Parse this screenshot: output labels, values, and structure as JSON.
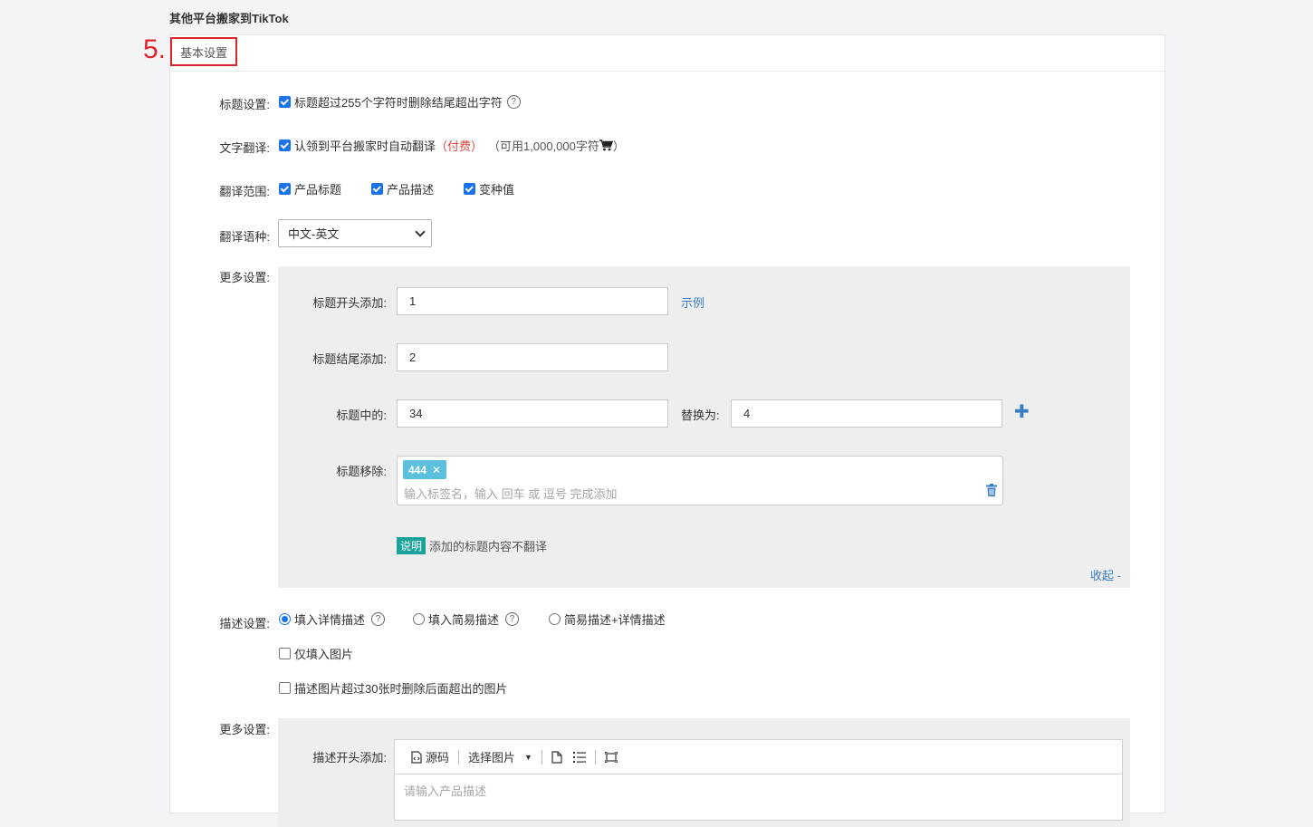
{
  "page_title": "其他平台搬家到TikTok",
  "step_marker": "5.",
  "tabs": {
    "basic_label": "基本设置"
  },
  "title_setting": {
    "label": "标题设置:",
    "checkbox_label": "标题超过255个字符时删除结尾超出字符",
    "checked": true
  },
  "text_translation": {
    "label": "文字翻译:",
    "checkbox_label": "认领到平台搬家时自动翻译",
    "paid_label": "（付费）",
    "quota_prefix": "（可用1,000,000字符",
    "quota_suffix": "）",
    "checked": true
  },
  "translation_scope": {
    "label": "翻译范围:",
    "options": [
      {
        "label": "产品标题",
        "checked": true
      },
      {
        "label": "产品描述",
        "checked": true
      },
      {
        "label": "变种值",
        "checked": true
      }
    ]
  },
  "translation_language": {
    "label": "翻译语种:",
    "selected": "中文-英文"
  },
  "more_settings_title": {
    "label": "更多设置:",
    "prefix_label": "标题开头添加:",
    "prefix_value": "1",
    "example_link": "示例",
    "suffix_label": "标题结尾添加:",
    "suffix_value": "2",
    "replace_label": "标题中的:",
    "replace_from": "34",
    "replace_to_label": "替换为:",
    "replace_to": "4",
    "remove_label": "标题移除:",
    "remove_tag": "444",
    "remove_placeholder": "输入标签名，输入 回车 或 逗号 完成添加",
    "note_badge": "说明",
    "note_text": "添加的标题内容不翻译",
    "collapse_link": "收起 -"
  },
  "description_setting": {
    "label": "描述设置:",
    "radios": [
      {
        "label": "填入详情描述",
        "selected": true,
        "help": true
      },
      {
        "label": "填入简易描述",
        "selected": false,
        "help": true
      },
      {
        "label": "简易描述+详情描述",
        "selected": false,
        "help": false
      }
    ],
    "images_only": {
      "label": "仅填入图片",
      "checked": false
    },
    "image_limit": {
      "label": "描述图片超过30张时删除后面超出的图片",
      "checked": false
    }
  },
  "more_settings_desc": {
    "label": "更多设置:",
    "prefix_label": "描述开头添加:",
    "toolbar": {
      "source": "源码",
      "select_image": "选择图片"
    },
    "placeholder": "请输入产品描述"
  }
}
